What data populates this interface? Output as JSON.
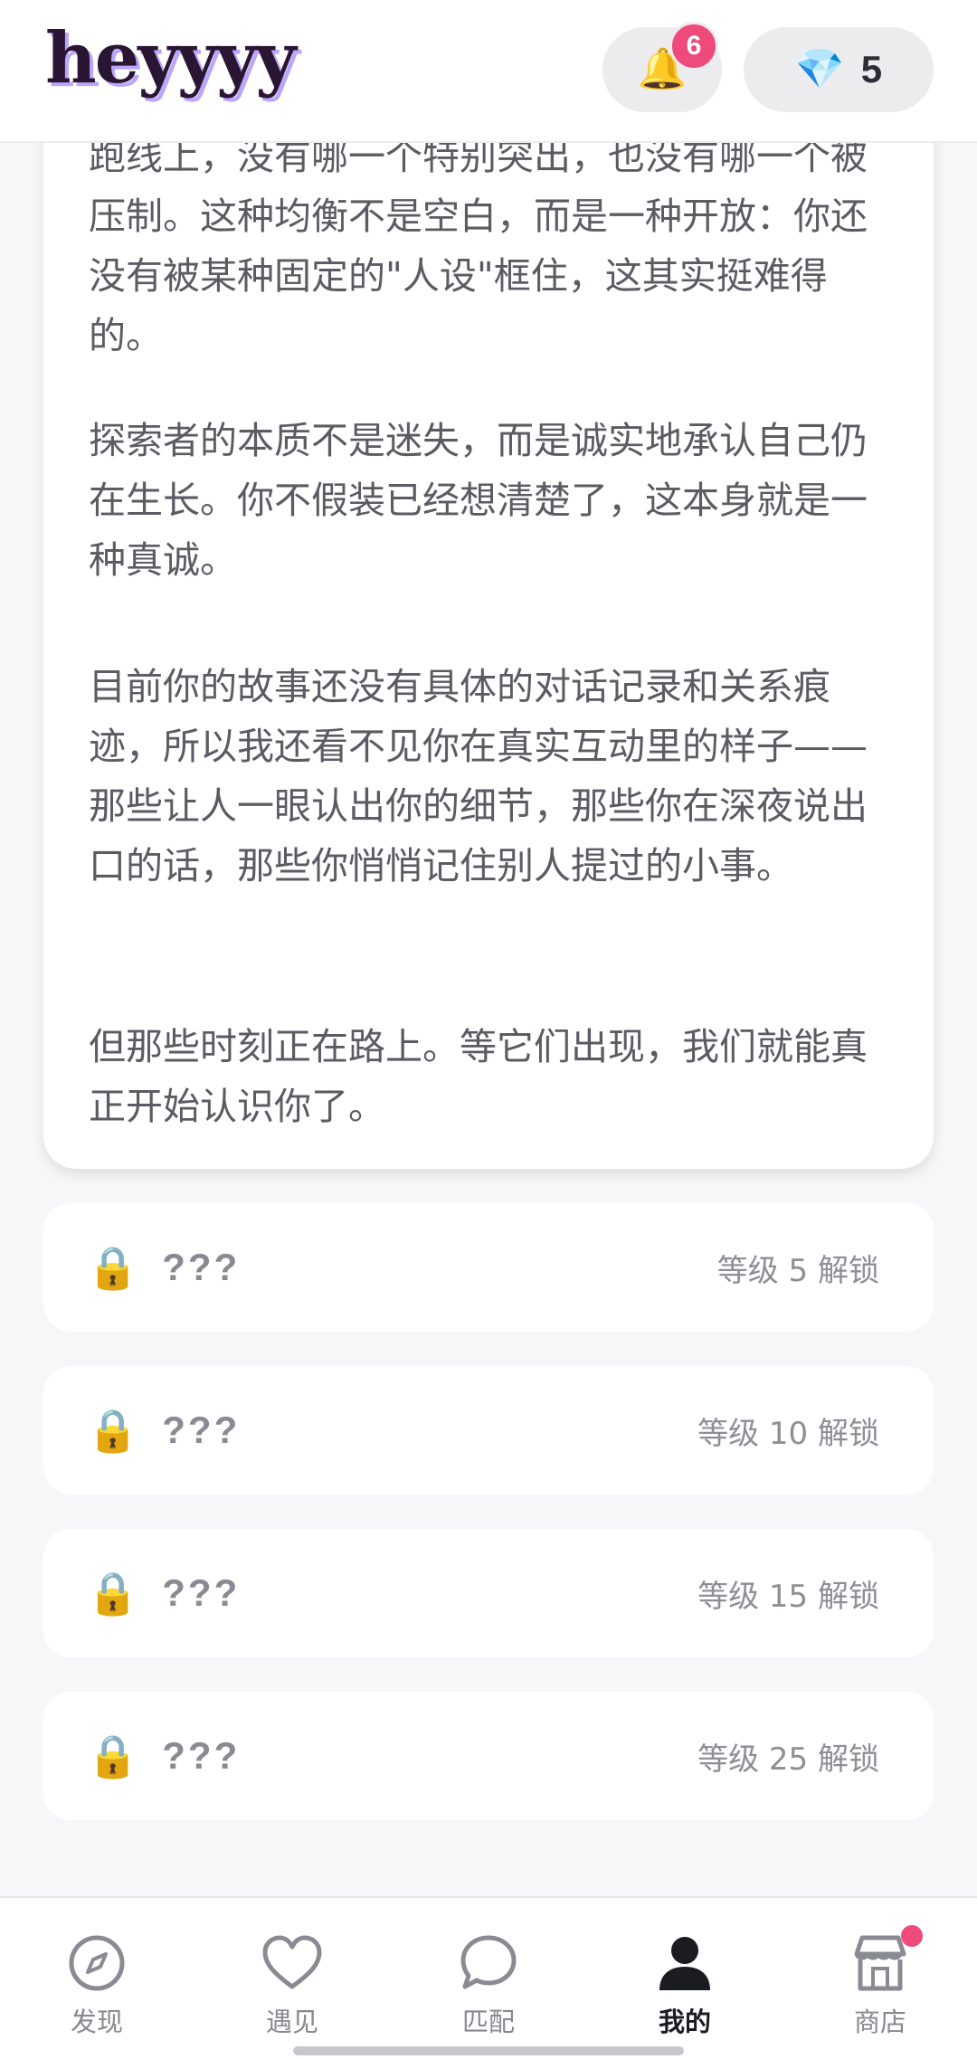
{
  "header": {
    "logo": "heyyyy",
    "bell_icon": "bell-icon",
    "notification_count": "6",
    "gem_icon": "gem-icon",
    "gem_count": "5"
  },
  "story": {
    "paragraphs": [
      "跑线上，没有哪一个特别突出，也没有哪一个被压制。这种均衡不是空白，而是一种开放：你还没有被某种固定的\"人设\"框住，这其实挺难得的。",
      "探索者的本质不是迷失，而是诚实地承认自己仍在生长。你不假装已经想清楚了，这本身就是一种真诚。",
      "目前你的故事还没有具体的对话记录和关系痕迹，所以我还看不见你在真实互动里的样子——那些让人一眼认出你的细节，那些你在深夜说出口的话，那些你悄悄记住别人提过的小事。",
      "但那些时刻正在路上。等它们出现，我们就能真正开始认识你了。"
    ]
  },
  "locked_items": [
    {
      "icon": "lock-icon",
      "title": "???",
      "hint": "等级 5 解锁"
    },
    {
      "icon": "lock-icon",
      "title": "???",
      "hint": "等级 10 解锁"
    },
    {
      "icon": "lock-icon",
      "title": "???",
      "hint": "等级 15 解锁"
    },
    {
      "icon": "lock-icon",
      "title": "???",
      "hint": "等级 25 解锁"
    }
  ],
  "nav": {
    "items": [
      {
        "icon": "compass-icon",
        "label": "发现",
        "active": false
      },
      {
        "icon": "heart-icon",
        "label": "遇见",
        "active": false
      },
      {
        "icon": "chat-bubble-icon",
        "label": "匹配",
        "active": false
      },
      {
        "icon": "person-icon",
        "label": "我的",
        "active": true
      },
      {
        "icon": "store-icon",
        "label": "商店",
        "active": false
      }
    ]
  },
  "colors": {
    "brand_text": "#2a1633",
    "brand_shadow": "#b9a6ff",
    "badge": "#ee4a7b",
    "body_text": "#5b5b63",
    "muted_text": "#8e8e96",
    "active_nav": "#1b1b22"
  }
}
